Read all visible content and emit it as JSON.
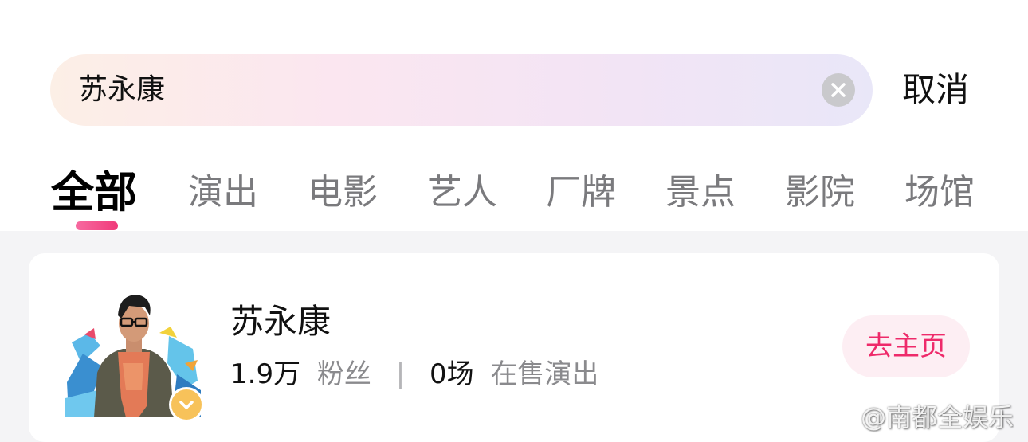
{
  "search": {
    "query": "苏永康",
    "cancel_label": "取消"
  },
  "tabs": [
    {
      "label": "全部",
      "active": true
    },
    {
      "label": "演出",
      "active": false
    },
    {
      "label": "电影",
      "active": false
    },
    {
      "label": "艺人",
      "active": false
    },
    {
      "label": "厂牌",
      "active": false
    },
    {
      "label": "景点",
      "active": false
    },
    {
      "label": "影院",
      "active": false
    },
    {
      "label": "场馆",
      "active": false
    }
  ],
  "result": {
    "name": "苏永康",
    "fans_count": "1.9万",
    "fans_label": "粉丝",
    "separator": "|",
    "shows_count": "0场",
    "shows_label": "在售演出",
    "home_button": "去主页"
  },
  "watermark": "@南都全娱乐",
  "colors": {
    "accent": "#ee2a6a",
    "tab_indicator": "#f03a7a",
    "badge": "#f7c25a"
  }
}
